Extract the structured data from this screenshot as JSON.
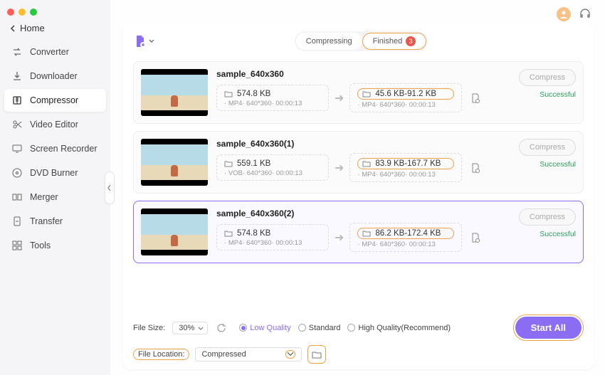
{
  "home": {
    "label": "Home"
  },
  "sidebar": {
    "items": [
      {
        "label": "Converter"
      },
      {
        "label": "Downloader"
      },
      {
        "label": "Compressor"
      },
      {
        "label": "Video Editor"
      },
      {
        "label": "Screen Recorder"
      },
      {
        "label": "DVD Burner"
      },
      {
        "label": "Merger"
      },
      {
        "label": "Transfer"
      },
      {
        "label": "Tools"
      }
    ],
    "activeIndex": 2
  },
  "tabs": {
    "compressing": "Compressing",
    "finished": "Finished",
    "finishedCount": "3"
  },
  "files": [
    {
      "name": "sample_640x360",
      "src": {
        "size": "574.8 KB",
        "format": "MP4",
        "res": "640*360",
        "dur": "00:00:13"
      },
      "dst": {
        "size": "45.6 KB-91.2 KB",
        "format": "MP4",
        "res": "640*360",
        "dur": "00:00:13"
      },
      "button": "Compress",
      "status": "Successful"
    },
    {
      "name": "sample_640x360(1)",
      "src": {
        "size": "559.1 KB",
        "format": "VOB",
        "res": "640*360",
        "dur": "00:00:13"
      },
      "dst": {
        "size": "83.9 KB-167.7 KB",
        "format": "MP4",
        "res": "640*360",
        "dur": "00:00:13"
      },
      "button": "Compress",
      "status": "Successful"
    },
    {
      "name": "sample_640x360(2)",
      "src": {
        "size": "574.8 KB",
        "format": "MP4",
        "res": "640*360",
        "dur": "00:00:13"
      },
      "dst": {
        "size": "86.2 KB-172.4 KB",
        "format": "MP4",
        "res": "640*360",
        "dur": "00:00:13"
      },
      "button": "Compress",
      "status": "Successful"
    }
  ],
  "footer": {
    "fileSizeLabel": "File Size:",
    "fileSizeValue": "30%",
    "quality": {
      "low": "Low Quality",
      "standard": "Standard",
      "high": "High Quality(Recommend)",
      "selected": "low"
    },
    "fileLocationLabel": "File Location:",
    "fileLocationValue": "Compressed",
    "startAll": "Start All"
  }
}
